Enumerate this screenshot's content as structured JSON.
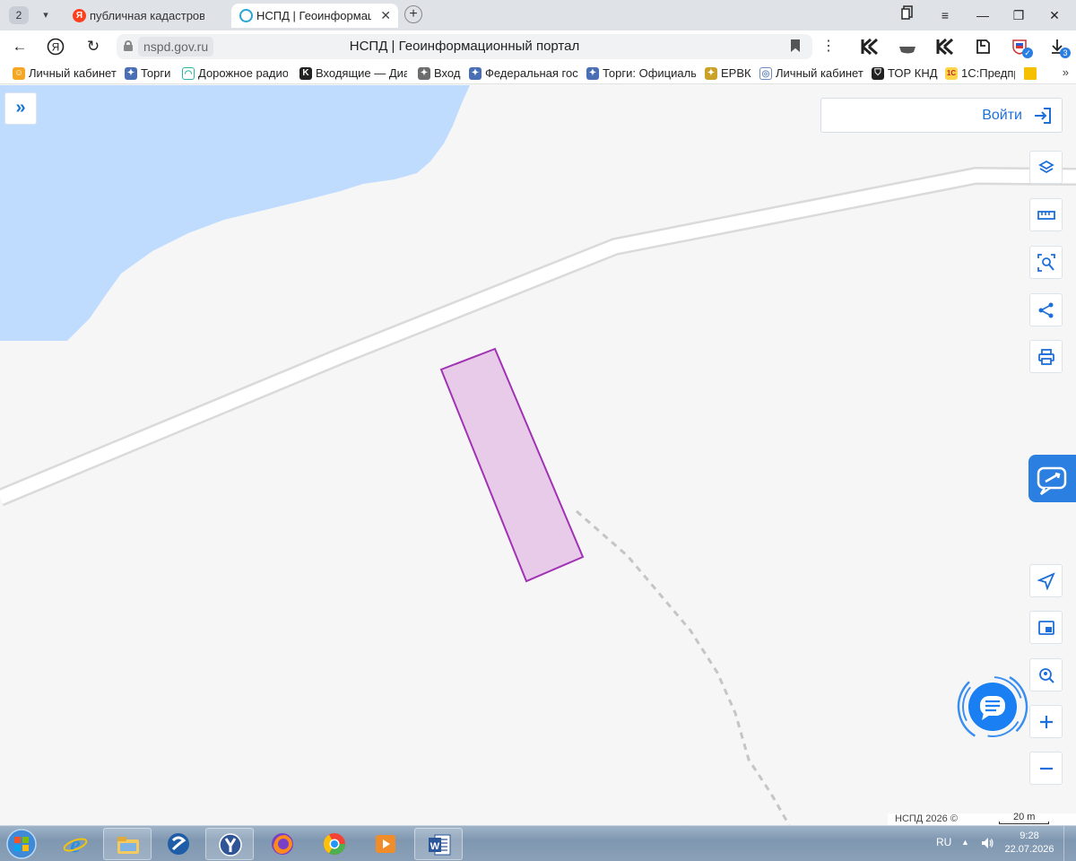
{
  "browser": {
    "tab_counter": "2",
    "tabs": [
      {
        "title": "публичная кадастровая к",
        "favicon": "yandex-favicon",
        "active": false
      },
      {
        "title": "НСПД | Геоинформац",
        "favicon": "nspd-favicon",
        "active": true
      }
    ],
    "address": {
      "domain": "nspd.gov.ru",
      "page_title": "НСПД | Геоинформационный портал"
    },
    "extensions": [
      {
        "icon": "kontur-icon"
      },
      {
        "icon": "hat-icon"
      },
      {
        "icon": "kontur-icon"
      },
      {
        "icon": "sticker-icon"
      },
      {
        "icon": "gosuslugi-shield-icon"
      },
      {
        "icon": "downloads-icon",
        "badge": "3"
      }
    ],
    "bookmarks": [
      {
        "label": "Личный кабинет",
        "icon": "smiley-icon"
      },
      {
        "label": "Торги",
        "icon": "eagle-icon"
      },
      {
        "label": "Дорожное радио",
        "icon": "radio-icon"
      },
      {
        "label": "Входящие — Диа",
        "icon": "k-letter-icon"
      },
      {
        "label": "Вход",
        "icon": "eagle-icon"
      },
      {
        "label": "Федеральная гос",
        "icon": "eagle-icon"
      },
      {
        "label": "Торги: Официаль",
        "icon": "eagle-icon"
      },
      {
        "label": "ЕРВК",
        "icon": "emblem-icon"
      },
      {
        "label": "Личный кабинет",
        "icon": "globe-icon"
      },
      {
        "label": "ТОР КНД",
        "icon": "shield-icon"
      },
      {
        "label": "1С:Предпр",
        "icon": "1c-icon"
      },
      {
        "label": "",
        "icon": "yellow-square-icon"
      }
    ]
  },
  "map": {
    "login_label": "Войти",
    "tools": [
      {
        "name": "layers-icon"
      },
      {
        "name": "ruler-icon"
      },
      {
        "name": "area-search-icon"
      },
      {
        "name": "share-icon"
      },
      {
        "name": "print-icon"
      }
    ],
    "bottom_tools": [
      {
        "name": "locate-icon"
      },
      {
        "name": "minimap-icon"
      },
      {
        "name": "geo-search-icon"
      },
      {
        "name": "zoom-in-icon"
      },
      {
        "name": "zoom-out-icon"
      }
    ],
    "attribution": "НСПД 2026 ©",
    "scale": "20 m",
    "colors": {
      "water": "#bfdcff",
      "parcel_fill": "#e8cbe8",
      "parcel_stroke": "#a033b4",
      "accent": "#1e6fd9"
    }
  },
  "taskbar": {
    "apps": [
      {
        "name": "internet-explorer-icon",
        "pinned": false
      },
      {
        "name": "file-explorer-icon",
        "pinned": true
      },
      {
        "name": "ruble-app-icon",
        "pinned": false
      },
      {
        "name": "yandex-browser-icon",
        "pinned": true
      },
      {
        "name": "firefox-icon",
        "pinned": false
      },
      {
        "name": "chrome-like-icon",
        "pinned": false
      },
      {
        "name": "media-player-icon",
        "pinned": false
      },
      {
        "name": "word-icon",
        "pinned": true
      }
    ],
    "language": "RU",
    "time": "9:28",
    "date": "22.07.2026"
  }
}
